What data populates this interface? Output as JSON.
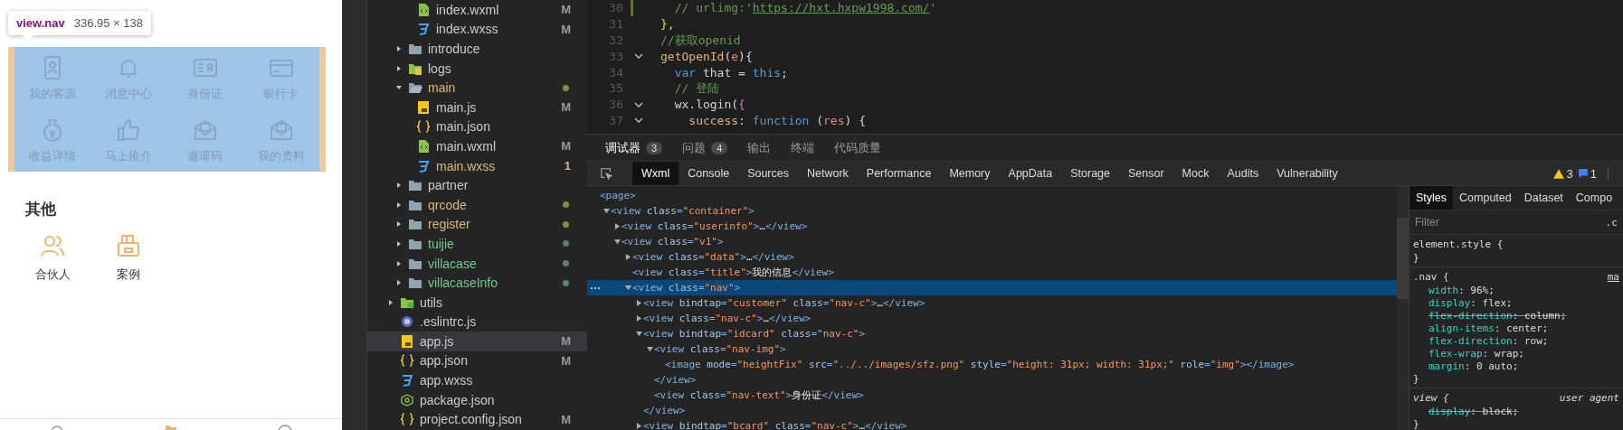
{
  "simulator": {
    "inspect_tooltip": {
      "selector": "view.nav",
      "size": "336.95 × 138"
    },
    "nav_items": [
      {
        "label": "我的客源",
        "kind": "contact"
      },
      {
        "label": "消息中心",
        "kind": "bell"
      },
      {
        "label": "身份证",
        "kind": "idcard"
      },
      {
        "label": "银行卡",
        "kind": "bankcard"
      },
      {
        "label": "收益详情",
        "kind": "moneybag"
      },
      {
        "label": "马上推介",
        "kind": "thumbup"
      },
      {
        "label": "邀请码",
        "kind": "mail"
      },
      {
        "label": "我的资料",
        "kind": "mail"
      }
    ],
    "section_title": "其他",
    "other_items": [
      {
        "label": "合伙人",
        "kind": "people"
      },
      {
        "label": "案例",
        "kind": "case"
      }
    ]
  },
  "file_tree": {
    "items": [
      {
        "children": [
          {
            "children": [
              {
                "name": "index.wxml",
                "kind": "wxml",
                "color": "#cccccc",
                "badge": {
                  "text": "M",
                  "color": "#9a9a9a"
                },
                "selected": false
              },
              {
                "name": "index.wxss",
                "kind": "wxss",
                "color": "#cccccc",
                "badge": {
                  "text": "M",
                  "color": "#9a9a9a"
                },
                "selected": false
              }
            ]
          },
          {
            "name": "introduce",
            "kind": "folder",
            "color": "#cccccc",
            "expanded": false,
            "selected": false
          },
          {
            "name": "logs",
            "kind": "logs",
            "color": "#cccccc",
            "expanded": false,
            "selected": false
          },
          {
            "name": "main",
            "kind": "folder",
            "color": "#d7ba7d",
            "dot": {
              "color": "#8c8a3a"
            },
            "expanded": true,
            "selected": false,
            "children": [
              {
                "name": "main.js",
                "kind": "js",
                "color": "#cccccc",
                "badge": {
                  "text": "M",
                  "color": "#9a9a9a"
                },
                "selected": false
              },
              {
                "name": "main.json",
                "kind": "json",
                "color": "#cccccc",
                "selected": false
              },
              {
                "name": "main.wxml",
                "kind": "wxml",
                "color": "#cccccc",
                "badge": {
                  "text": "M",
                  "color": "#9a9a9a"
                },
                "selected": false
              },
              {
                "name": "main.wxss",
                "kind": "wxss",
                "color": "#d7ba7d",
                "badge": {
                  "text": "1",
                  "color": "#d7ba7d"
                },
                "selected": false
              }
            ]
          },
          {
            "name": "partner",
            "kind": "folder",
            "color": "#cccccc",
            "expanded": false,
            "selected": false
          },
          {
            "name": "qrcode",
            "kind": "folder",
            "color": "#d7ba7d",
            "dot": {
              "color": "#8c8a3a"
            },
            "expanded": false,
            "selected": false
          },
          {
            "name": "register",
            "kind": "folder",
            "color": "#d7ba7d",
            "dot": {
              "color": "#8c8a3a"
            },
            "expanded": false,
            "selected": false
          },
          {
            "name": "tuijie",
            "kind": "folder",
            "color": "#73c991",
            "dot": {
              "color": "#5f7f60"
            },
            "expanded": false,
            "selected": false
          },
          {
            "name": "villacase",
            "kind": "folder",
            "color": "#73c991",
            "dot": {
              "color": "#5f7f70"
            },
            "expanded": false,
            "selected": false
          },
          {
            "name": "villacaseInfo",
            "kind": "folder",
            "color": "#73c991",
            "dot": {
              "color": "#5f7f70"
            },
            "expanded": false,
            "selected": false
          }
        ]
      },
      {
        "name": "utils",
        "kind": "utils",
        "color": "#cccccc",
        "expanded": false,
        "selected": false
      },
      {
        "name": ".eslintrc.js",
        "kind": "eslint",
        "color": "#cccccc",
        "selected": false
      },
      {
        "name": "app.js",
        "kind": "js",
        "color": "#cccccc",
        "badge": {
          "text": "M",
          "color": "#9a9a9a"
        },
        "selected": true
      },
      {
        "name": "app.json",
        "kind": "json",
        "color": "#cccccc",
        "badge": {
          "text": "M",
          "color": "#9a9a9a"
        },
        "selected": false
      },
      {
        "name": "app.wxss",
        "kind": "wxss",
        "color": "#cccccc",
        "selected": false
      },
      {
        "name": "package.json",
        "kind": "npm",
        "color": "#cccccc",
        "selected": false
      },
      {
        "name": "project.config.json",
        "kind": "json",
        "color": "#cccccc",
        "badge": {
          "text": "M",
          "color": "#9a9a9a"
        },
        "selected": false
      }
    ]
  },
  "editor": {
    "lines": [
      {
        "number": "30",
        "changed": true,
        "fold": false,
        "tokens": [
          {
            "kind": "comment",
            "t": "  // urlimg:'"
          },
          {
            "kind": "link",
            "t": "https://hxt.hxpw1998.com/"
          },
          {
            "kind": "comment",
            "t": "'"
          }
        ]
      },
      {
        "number": "31",
        "changed": false,
        "fold": false,
        "tokens": [
          {
            "kind": "brace",
            "t": "}"
          },
          {
            "kind": "plain",
            "t": ","
          }
        ]
      },
      {
        "number": "32",
        "changed": false,
        "fold": false,
        "tokens": [
          {
            "kind": "comment",
            "t": "//获取openid"
          }
        ]
      },
      {
        "number": "33",
        "changed": false,
        "fold": true,
        "tokens": [
          {
            "kind": "func",
            "t": "getOpenId"
          },
          {
            "kind": "plain",
            "t": "("
          },
          {
            "kind": "param",
            "t": "e"
          },
          {
            "kind": "plain",
            "t": "){"
          }
        ]
      },
      {
        "number": "34",
        "changed": false,
        "fold": false,
        "tokens": [
          {
            "kind": "keyword",
            "t": "  var"
          },
          {
            "kind": "plain",
            "t": " that = "
          },
          {
            "kind": "keyword",
            "t": "this"
          },
          {
            "kind": "plain",
            "t": ";"
          }
        ]
      },
      {
        "number": "35",
        "changed": false,
        "fold": false,
        "tokens": [
          {
            "kind": "comment",
            "t": "  // 登陆"
          }
        ]
      },
      {
        "number": "36",
        "changed": false,
        "fold": true,
        "tokens": [
          {
            "kind": "plain",
            "t": "  wx.login("
          },
          {
            "kind": "brace2",
            "t": "{"
          }
        ]
      },
      {
        "number": "37",
        "changed": false,
        "fold": true,
        "tokens": [
          {
            "kind": "func",
            "t": "    success"
          },
          {
            "kind": "plain",
            "t": ": "
          },
          {
            "kind": "keyword",
            "t": "function"
          },
          {
            "kind": "plain",
            "t": " ("
          },
          {
            "kind": "param",
            "t": "res"
          },
          {
            "kind": "plain",
            "t": ") {"
          }
        ]
      }
    ]
  },
  "devtools": {
    "panel_tabs": [
      {
        "label": "调试器",
        "count": "3",
        "selected": true
      },
      {
        "label": "问题",
        "count": "4",
        "selected": false
      },
      {
        "label": "输出",
        "selected": false
      },
      {
        "label": "终端",
        "selected": false
      },
      {
        "label": "代码质量",
        "selected": false
      }
    ],
    "tool_tabs": [
      {
        "label": "Wxml",
        "selected": true
      },
      {
        "label": "Console",
        "selected": false
      },
      {
        "label": "Sources",
        "selected": false
      },
      {
        "label": "Network",
        "selected": false
      },
      {
        "label": "Performance",
        "selected": false
      },
      {
        "label": "Memory",
        "selected": false
      },
      {
        "label": "AppData",
        "selected": false
      },
      {
        "label": "Storage",
        "selected": false
      },
      {
        "label": "Sensor",
        "selected": false
      },
      {
        "label": "Mock",
        "selected": false
      },
      {
        "label": "Audits",
        "selected": false
      },
      {
        "label": "Vulnerability",
        "selected": false
      }
    ],
    "warnings": "3",
    "messages": "1",
    "wxml_tree": [
      {
        "selected": false,
        "parts": [
          {
            "kind": "tag",
            "t": "<page>"
          }
        ],
        "children": [
          {
            "selected": false,
            "expanded": true,
            "parts": [
              {
                "kind": "tag",
                "t": "<view"
              },
              {
                "kind": "attr",
                "t": " class"
              },
              {
                "kind": "tag",
                "t": "="
              },
              {
                "kind": "val",
                "t": "\"container\""
              },
              {
                "kind": "tag",
                "t": ">"
              }
            ],
            "children": [
              {
                "selected": false,
                "expanded": false,
                "parts": [
                  {
                    "kind": "tag",
                    "t": "<view"
                  },
                  {
                    "kind": "attr",
                    "t": " class"
                  },
                  {
                    "kind": "tag",
                    "t": "="
                  },
                  {
                    "kind": "val",
                    "t": "\"userinfo\""
                  },
                  {
                    "kind": "tag",
                    "t": ">"
                  },
                  {
                    "kind": "text",
                    "t": "…"
                  },
                  {
                    "kind": "tag",
                    "t": "</view>"
                  }
                ]
              },
              {
                "selected": false,
                "expanded": true,
                "parts": [
                  {
                    "kind": "tag",
                    "t": "<view"
                  },
                  {
                    "kind": "attr",
                    "t": " class"
                  },
                  {
                    "kind": "tag",
                    "t": "="
                  },
                  {
                    "kind": "val",
                    "t": "\"v1\""
                  },
                  {
                    "kind": "tag",
                    "t": ">"
                  }
                ],
                "children": [
                  {
                    "selected": false,
                    "expanded": false,
                    "parts": [
                      {
                        "kind": "tag",
                        "t": "<view"
                      },
                      {
                        "kind": "attr",
                        "t": " class"
                      },
                      {
                        "kind": "tag",
                        "t": "="
                      },
                      {
                        "kind": "val",
                        "t": "\"data\""
                      },
                      {
                        "kind": "tag",
                        "t": ">"
                      },
                      {
                        "kind": "text",
                        "t": "…"
                      },
                      {
                        "kind": "tag",
                        "t": "</view>"
                      }
                    ]
                  },
                  {
                    "selected": false,
                    "parts": [
                      {
                        "kind": "tag",
                        "t": "<view"
                      },
                      {
                        "kind": "attr",
                        "t": " class"
                      },
                      {
                        "kind": "tag",
                        "t": "="
                      },
                      {
                        "kind": "val",
                        "t": "\"title\""
                      },
                      {
                        "kind": "tag",
                        "t": ">"
                      },
                      {
                        "kind": "text",
                        "t": "我的信息"
                      },
                      {
                        "kind": "tag",
                        "t": "</view>"
                      }
                    ]
                  },
                  {
                    "selected": true,
                    "expanded": true,
                    "parts": [
                      {
                        "kind": "tag",
                        "t": "<view"
                      },
                      {
                        "kind": "attr",
                        "t": " class"
                      },
                      {
                        "kind": "tag",
                        "t": "="
                      },
                      {
                        "kind": "val",
                        "t": "\"nav\""
                      },
                      {
                        "kind": "tag",
                        "t": ">"
                      }
                    ],
                    "children": [
                      {
                        "selected": false,
                        "expanded": false,
                        "parts": [
                          {
                            "kind": "tag",
                            "t": "<view"
                          },
                          {
                            "kind": "attr",
                            "t": " bindtap"
                          },
                          {
                            "kind": "tag",
                            "t": "="
                          },
                          {
                            "kind": "val",
                            "t": "\"customer\""
                          },
                          {
                            "kind": "attr",
                            "t": " class"
                          },
                          {
                            "kind": "tag",
                            "t": "="
                          },
                          {
                            "kind": "val",
                            "t": "\"nav-c\""
                          },
                          {
                            "kind": "tag",
                            "t": ">"
                          },
                          {
                            "kind": "text",
                            "t": "…"
                          },
                          {
                            "kind": "tag",
                            "t": "</view>"
                          }
                        ]
                      },
                      {
                        "selected": false,
                        "expanded": false,
                        "parts": [
                          {
                            "kind": "tag",
                            "t": "<view"
                          },
                          {
                            "kind": "attr",
                            "t": " class"
                          },
                          {
                            "kind": "tag",
                            "t": "="
                          },
                          {
                            "kind": "val",
                            "t": "\"nav-c\""
                          },
                          {
                            "kind": "tag",
                            "t": ">"
                          },
                          {
                            "kind": "text",
                            "t": "…"
                          },
                          {
                            "kind": "tag",
                            "t": "</view>"
                          }
                        ]
                      },
                      {
                        "selected": false,
                        "expanded": true,
                        "parts": [
                          {
                            "kind": "tag",
                            "t": "<view"
                          },
                          {
                            "kind": "attr",
                            "t": " bindtap"
                          },
                          {
                            "kind": "tag",
                            "t": "="
                          },
                          {
                            "kind": "val",
                            "t": "\"idcard\""
                          },
                          {
                            "kind": "attr",
                            "t": " class"
                          },
                          {
                            "kind": "tag",
                            "t": "="
                          },
                          {
                            "kind": "val",
                            "t": "\"nav-c\""
                          },
                          {
                            "kind": "tag",
                            "t": ">"
                          }
                        ],
                        "close": [
                          {
                            "kind": "tag",
                            "t": "</view>"
                          }
                        ],
                        "children": [
                          {
                            "selected": false,
                            "expanded": true,
                            "parts": [
                              {
                                "kind": "tag",
                                "t": "<view"
                              },
                              {
                                "kind": "attr",
                                "t": " class"
                              },
                              {
                                "kind": "tag",
                                "t": "="
                              },
                              {
                                "kind": "val",
                                "t": "\"nav-img\""
                              },
                              {
                                "kind": "tag",
                                "t": ">"
                              }
                            ],
                            "close": [
                              {
                                "kind": "tag",
                                "t": "</view>"
                              }
                            ],
                            "children": [
                              {
                                "selected": false,
                                "parts": [
                                  {
                                    "kind": "tag",
                                    "t": "<image"
                                  },
                                  {
                                    "kind": "attr",
                                    "t": " mode"
                                  },
                                  {
                                    "kind": "tag",
                                    "t": "="
                                  },
                                  {
                                    "kind": "val",
                                    "t": "\"heightFix\""
                                  },
                                  {
                                    "kind": "attr",
                                    "t": " src"
                                  },
                                  {
                                    "kind": "tag",
                                    "t": "="
                                  },
                                  {
                                    "kind": "val",
                                    "t": "\"../../images/sfz.png\""
                                  },
                                  {
                                    "kind": "attr",
                                    "t": " style"
                                  },
                                  {
                                    "kind": "tag",
                                    "t": "="
                                  },
                                  {
                                    "kind": "val",
                                    "t": "\"height: 31px; width: 31px;\""
                                  },
                                  {
                                    "kind": "attr",
                                    "t": " role"
                                  },
                                  {
                                    "kind": "tag",
                                    "t": "="
                                  },
                                  {
                                    "kind": "val",
                                    "t": "\"img\""
                                  },
                                  {
                                    "kind": "tag",
                                    "t": "></image>"
                                  }
                                ]
                              }
                            ]
                          },
                          {
                            "selected": false,
                            "parts": [
                              {
                                "kind": "tag",
                                "t": "<view"
                              },
                              {
                                "kind": "attr",
                                "t": " class"
                              },
                              {
                                "kind": "tag",
                                "t": "="
                              },
                              {
                                "kind": "val",
                                "t": "\"nav-text\""
                              },
                              {
                                "kind": "tag",
                                "t": ">"
                              },
                              {
                                "kind": "text",
                                "t": "身份证"
                              },
                              {
                                "kind": "tag",
                                "t": "</view>"
                              }
                            ]
                          }
                        ]
                      },
                      {
                        "selected": false,
                        "expanded": false,
                        "parts": [
                          {
                            "kind": "tag",
                            "t": "<view"
                          },
                          {
                            "kind": "attr",
                            "t": " bindtap"
                          },
                          {
                            "kind": "tag",
                            "t": "="
                          },
                          {
                            "kind": "val",
                            "t": "\"bcard\""
                          },
                          {
                            "kind": "attr",
                            "t": " class"
                          },
                          {
                            "kind": "tag",
                            "t": "="
                          },
                          {
                            "kind": "val",
                            "t": "\"nav-c\""
                          },
                          {
                            "kind": "tag",
                            "t": ">"
                          },
                          {
                            "kind": "text",
                            "t": "…"
                          },
                          {
                            "kind": "tag",
                            "t": "</view>"
                          }
                        ]
                      }
                    ]
                  }
                ]
              }
            ]
          }
        ]
      }
    ],
    "styles_panel": {
      "tabs": [
        {
          "label": "Styles",
          "selected": true
        },
        {
          "label": "Computed",
          "selected": false
        },
        {
          "label": "Dataset",
          "selected": false
        },
        {
          "label": "Compo",
          "selected": false
        }
      ],
      "filter": {
        "placeholder": "Filter"
      },
      "class_toggle": ".c",
      "rules": [
        {
          "kind": "inline",
          "selector": "element.style {",
          "close": "}"
        },
        {
          "kind": "author",
          "selector": ".nav {",
          "source": "ma",
          "close": "}",
          "props": [
            {
              "name": "width",
              "value": ": 96%;",
              "overridden": false
            },
            {
              "name": "display",
              "value": ": flex;",
              "overridden": false
            },
            {
              "name": "flex-direction",
              "value": ": column;",
              "overridden": true
            },
            {
              "name": "align-items",
              "value": ": center;",
              "overridden": false
            },
            {
              "name": "flex-direction",
              "value": ": row;",
              "overridden": false
            },
            {
              "name": "flex-wrap",
              "value": ": wrap;",
              "overridden": false
            },
            {
              "name": "margin",
              "value": ": 0 auto;",
              "overridden": false
            }
          ]
        },
        {
          "kind": "user-agent",
          "selector": "view {",
          "source": "user agent",
          "close": "}",
          "props": [
            {
              "name": "display",
              "value": ": block;",
              "overridden": true
            }
          ]
        }
      ]
    }
  }
}
